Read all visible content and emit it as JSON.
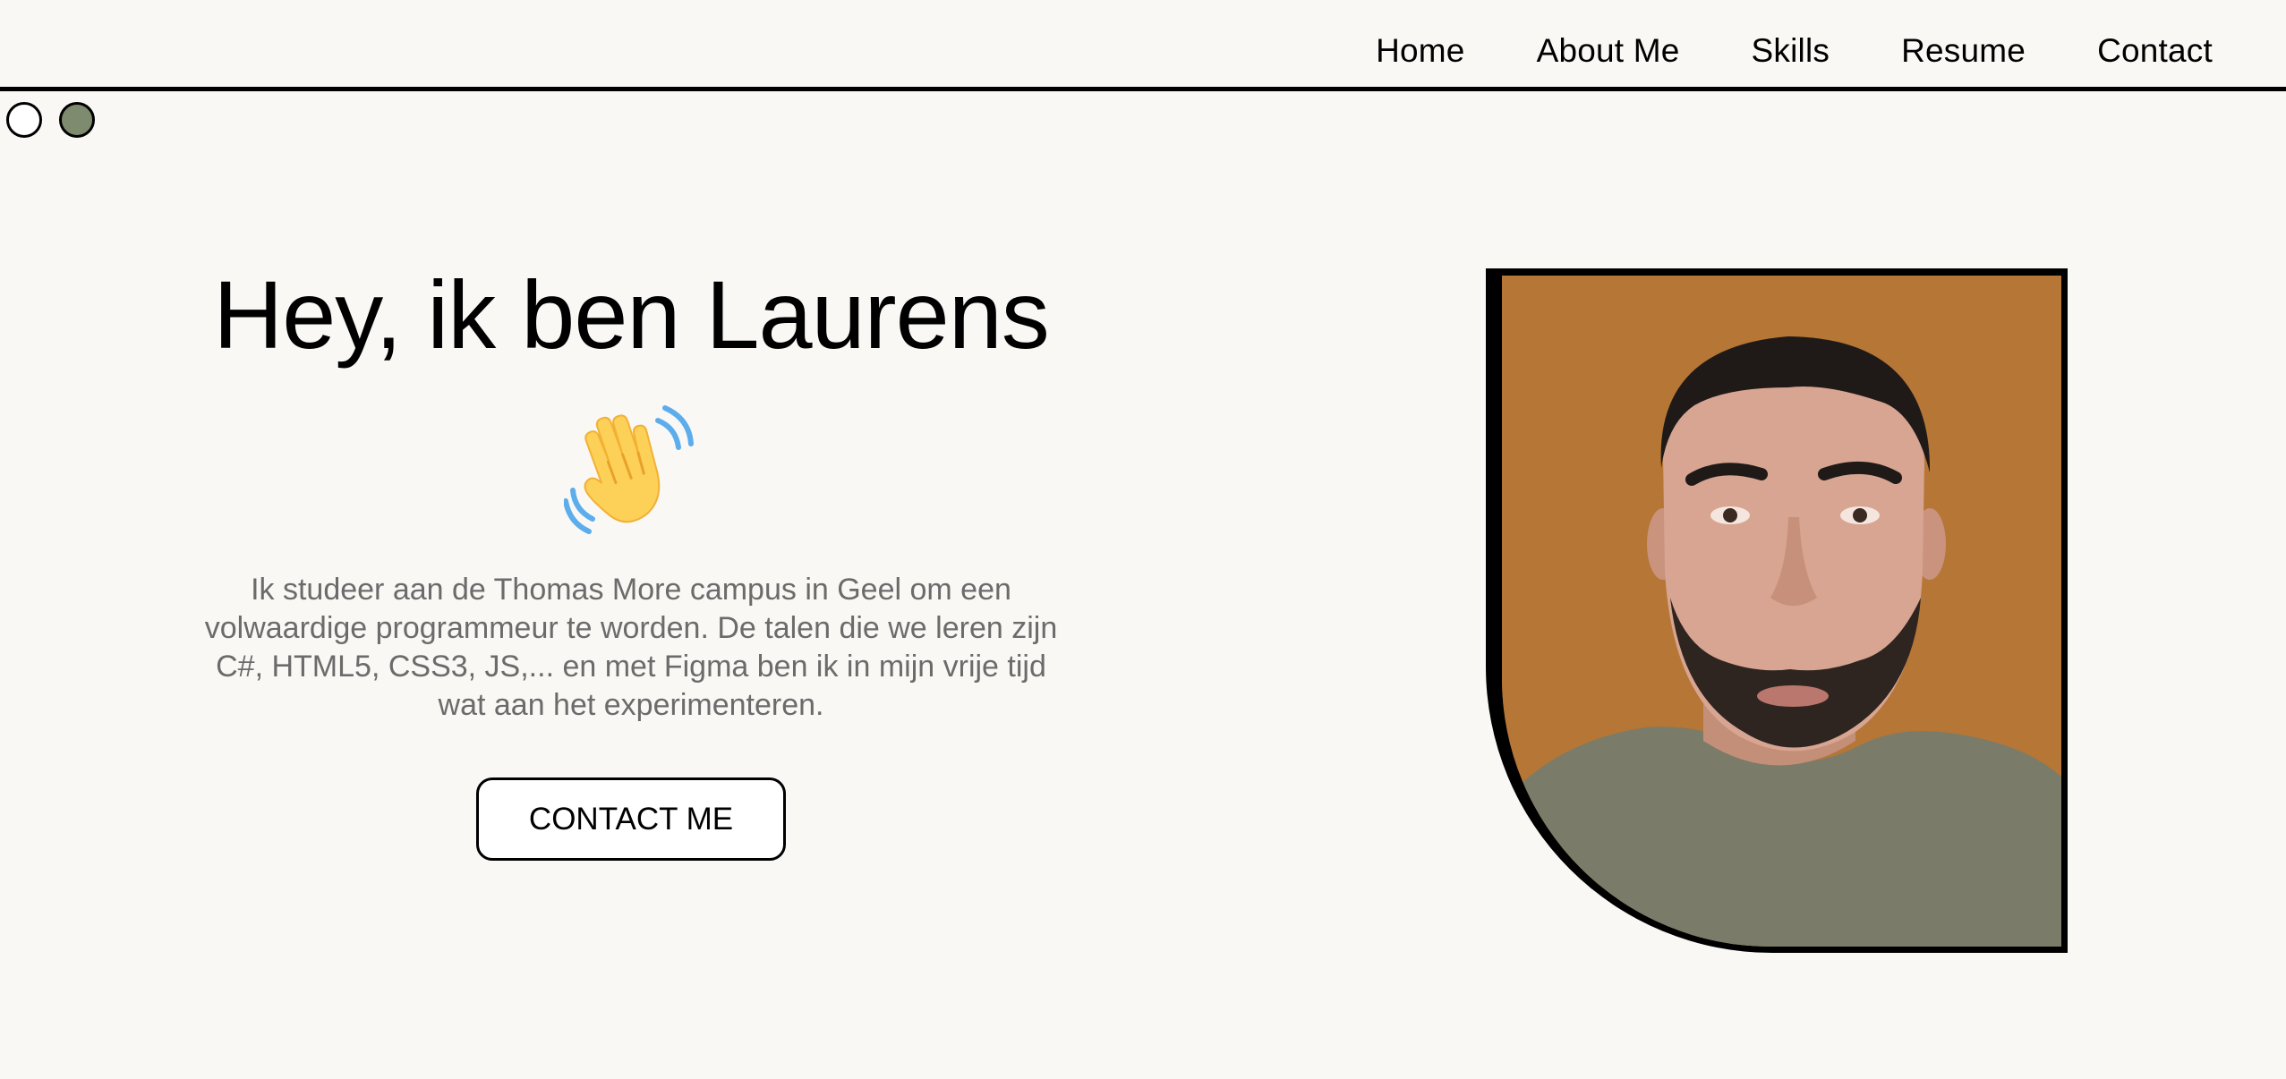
{
  "nav": {
    "items": [
      {
        "label": "Home"
      },
      {
        "label": "About Me"
      },
      {
        "label": "Skills"
      },
      {
        "label": "Resume"
      },
      {
        "label": "Contact"
      }
    ]
  },
  "theme": {
    "options": [
      {
        "name": "light",
        "color": "#ffffff"
      },
      {
        "name": "dark",
        "color": "#7e8b6f"
      }
    ]
  },
  "hero": {
    "title": "Hey, ik ben Laurens",
    "emoji_icon": "waving-hand-icon",
    "text": "Ik studeer aan de Thomas More campus in Geel om een volwaardige programmeur te worden. De talen die we leren zijn C#, HTML5, CSS3, JS,... en met Figma ben ik in mijn vrije tijd wat aan het experimenteren.",
    "button_label": "CONTACT ME"
  },
  "portrait": {
    "background_color": "#b67635",
    "shirt_color": "#7a7c69"
  }
}
